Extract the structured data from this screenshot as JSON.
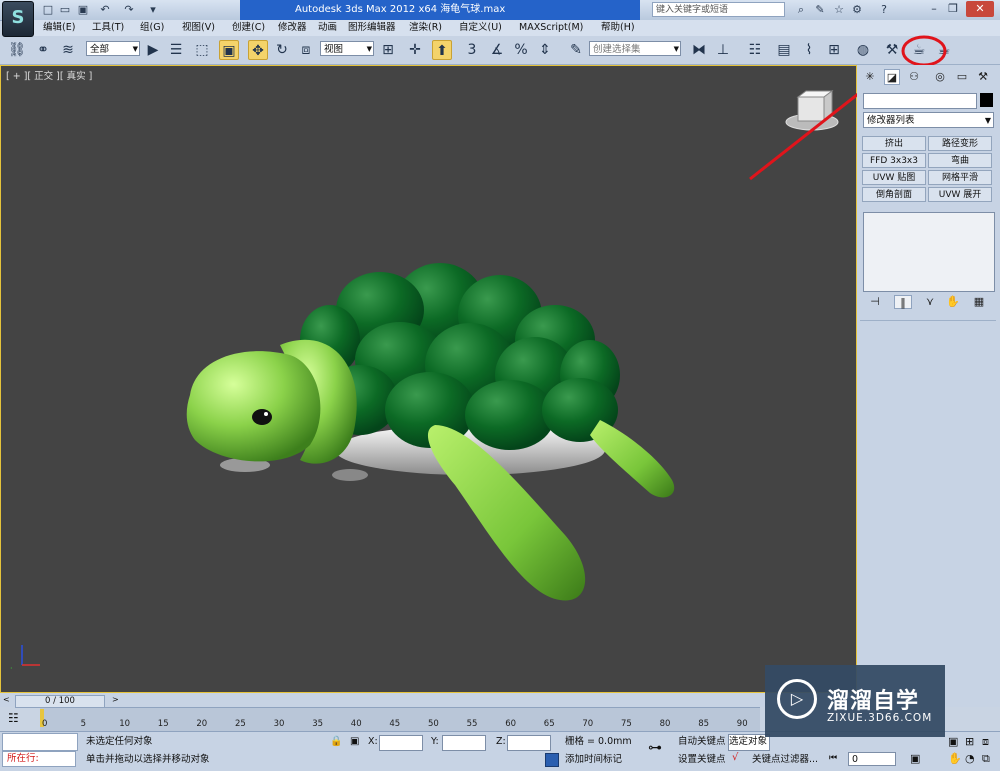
{
  "title_bar": {
    "title": "Autodesk 3ds Max  2012 x64   海龟气球.max",
    "search_placeholder": "键入关键字或短语"
  },
  "menu": [
    "编辑(E)",
    "工具(T)",
    "组(G)",
    "视图(V)",
    "创建(C)",
    "修改器",
    "动画",
    "图形编辑器",
    "渲染(R)",
    "自定义(U)",
    "MAXScript(M)",
    "帮助(H)"
  ],
  "toolbar": {
    "selection_filter": "全部",
    "ref_coord": "视图",
    "named_selection": "创建选择集",
    "snap_3": "3"
  },
  "viewport": {
    "label": "[ + ][ 正交 ][ 真实 ]",
    "background": "#444444",
    "border_color": "#e5c33b"
  },
  "command_panel": {
    "modifier_list": "修改器列表",
    "modifier_buttons": [
      "挤出",
      "路径变形",
      "FFD 3x3x3",
      "弯曲",
      "UVW 贴图",
      "网格平滑",
      "倒角剖面",
      "UVW 展开"
    ]
  },
  "timeline": {
    "frame_range": "0 / 100",
    "ticks": [
      "0",
      "5",
      "10",
      "15",
      "20",
      "25",
      "30",
      "35",
      "40",
      "45",
      "50",
      "55",
      "60",
      "65",
      "70",
      "75",
      "80",
      "85",
      "90"
    ]
  },
  "status": {
    "script_label": "所在行:",
    "prompt_line1": "未选定任何对象",
    "prompt_line2": "单击并拖动以选择并移动对象",
    "x_label": "X:",
    "y_label": "Y:",
    "z_label": "Z:",
    "grid": "栅格 = 0.0mm",
    "add_time_tag": "添加时间标记",
    "auto_key": "自动关键点",
    "set_key": "设置关键点",
    "selected": "选定对象",
    "key_filters": "关键点过滤器...",
    "current_frame": "0"
  },
  "watermark": {
    "title": "溜溜自学",
    "url": "ZIXUE.3D66.COM"
  },
  "annotation_color": "#e0141b"
}
